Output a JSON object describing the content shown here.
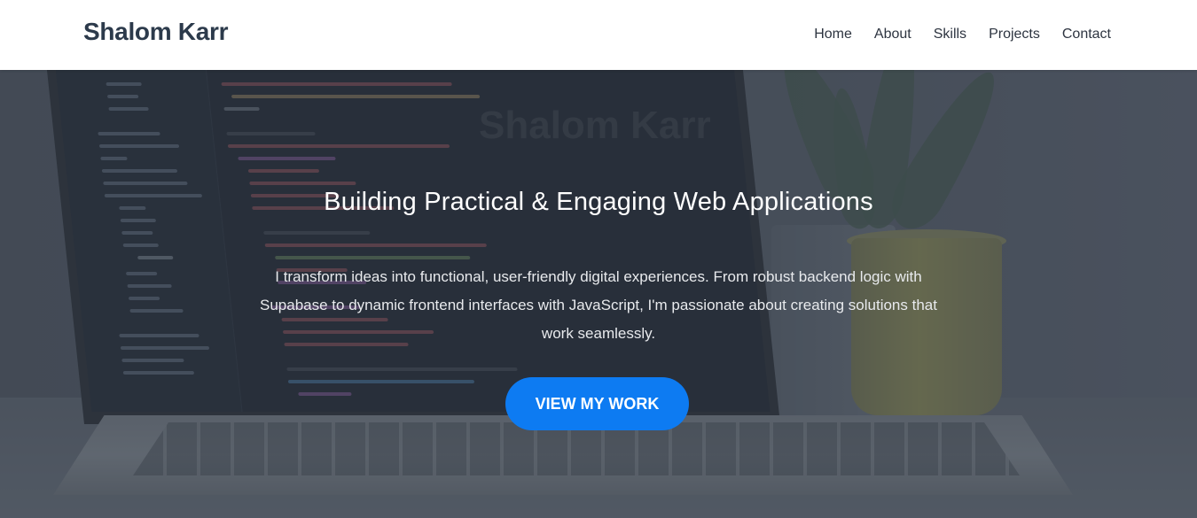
{
  "header": {
    "brand": "Shalom Karr",
    "nav": [
      "Home",
      "About",
      "Skills",
      "Projects",
      "Contact"
    ]
  },
  "hero": {
    "title": "Building Practical & Engaging Web Applications",
    "description": "I transform ideas into functional, user-friendly digital experiences. From robust backend logic with Supabase to dynamic frontend interfaces with JavaScript, I'm passionate about creating solutions that work seamlessly.",
    "cta_label": "VIEW MY WORK",
    "background_watermark": "Shalom Karr"
  },
  "colors": {
    "accent": "#0d7bf2",
    "brand_text": "#2c3a4b",
    "nav_bg": "#ffffff"
  }
}
